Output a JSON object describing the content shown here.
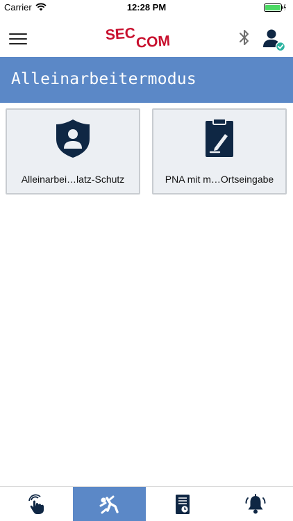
{
  "status_bar": {
    "carrier": "Carrier",
    "time": "12:28 PM"
  },
  "header": {
    "logo_text_left": "SEC",
    "logo_text_right": "COM",
    "logo_color": "#c8102e",
    "icons": [
      "menu-icon",
      "bluetooth-icon",
      "user-icon",
      "check-badge-icon"
    ]
  },
  "title": "Alleinarbeitermodus",
  "tiles": [
    {
      "label": "Alleinarbei…latz-Schutz",
      "icon": "shield-person-icon"
    },
    {
      "label": "PNA mit m…Ortseingabe",
      "icon": "clipboard-pen-icon"
    }
  ],
  "tab_bar": {
    "active_index": 1,
    "tabs": [
      {
        "icon": "touch-hand-icon"
      },
      {
        "icon": "falling-person-icon"
      },
      {
        "icon": "document-clock-icon"
      },
      {
        "icon": "alarm-bell-icon"
      }
    ]
  },
  "colors": {
    "accent": "#5b88c7",
    "tile_bg": "#eceff3",
    "icon_navy": "#0f2744",
    "battery_green": "#4cd964",
    "badge_teal": "#2bb3a0"
  }
}
